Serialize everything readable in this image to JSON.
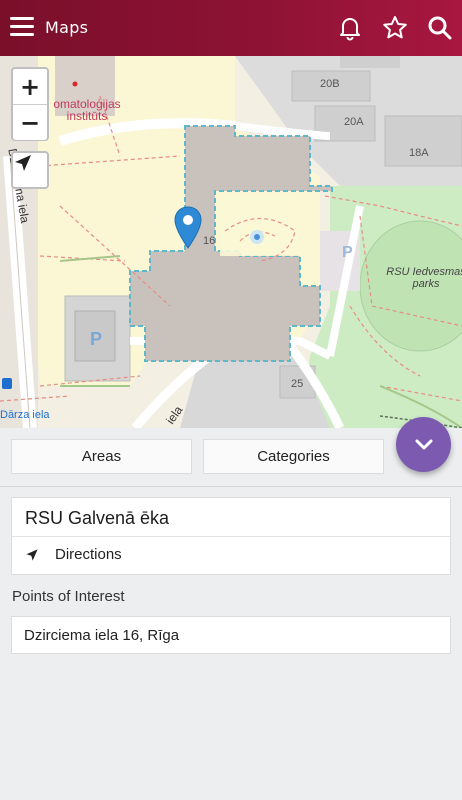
{
  "header": {
    "title": "Maps",
    "menu_icon": "hamburger-menu-icon",
    "icons": [
      "bell-icon",
      "star-icon",
      "search-icon"
    ],
    "color": "#8d1233"
  },
  "map": {
    "zoom_in": "+",
    "zoom_out": "−",
    "labels": {
      "institute_line1": "omatoloģijas",
      "institute_line2": "institūts",
      "street_west": "Dzirciema iela",
      "street_south": "iela",
      "street_darza": "Dārza iela",
      "house_16": "16",
      "house_20b": "20B",
      "house_20a": "20A",
      "house_18a": "18A",
      "house_25": "25",
      "park_line1": "RSU Iedvesmas",
      "park_line2": "parks",
      "parking": "P"
    }
  },
  "tabs": {
    "areas": "Areas",
    "categories": "Categories"
  },
  "fab_icon": "chevron-down-icon",
  "place": {
    "title": "RSU Galvenā ēka",
    "directions": "Directions"
  },
  "poi": {
    "section_label": "Points of Interest",
    "address": "Dzirciema iela 16, Rīga"
  }
}
